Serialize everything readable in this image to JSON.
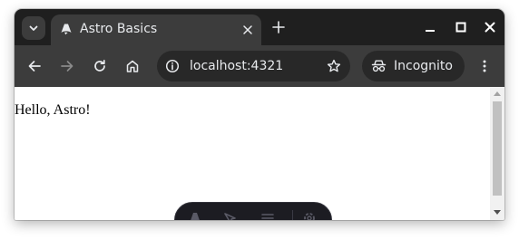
{
  "browser": {
    "tab": {
      "title": "Astro Basics",
      "favicon": "astro-logo-icon"
    },
    "address_bar": {
      "url": "localhost:4321"
    },
    "incognito_label": "Incognito",
    "icons": {
      "tab_search": "chevron-down-icon",
      "tab_close": "close-icon",
      "new_tab": "plus-icon",
      "back": "arrow-left-icon",
      "forward": "arrow-right-icon",
      "reload": "reload-icon",
      "home": "home-icon",
      "site_info": "info-icon",
      "bookmark": "star-icon",
      "incognito": "incognito-icon",
      "menu": "kebab-menu-icon",
      "minimize": "minimize-icon",
      "maximize": "maximize-icon",
      "close_window": "close-icon"
    },
    "colors": {
      "tabstrip": "#1f1f1f",
      "toolbar": "#3c3c3c",
      "omnibox": "#282828",
      "text": "#e8eaed"
    }
  },
  "page": {
    "body_text": "Hello, Astro!"
  },
  "dev_toolbar": {
    "icons": [
      "astro-menu-icon",
      "inspect-icon",
      "audit-icon",
      "settings-icon"
    ],
    "background": "#1c1c22"
  }
}
